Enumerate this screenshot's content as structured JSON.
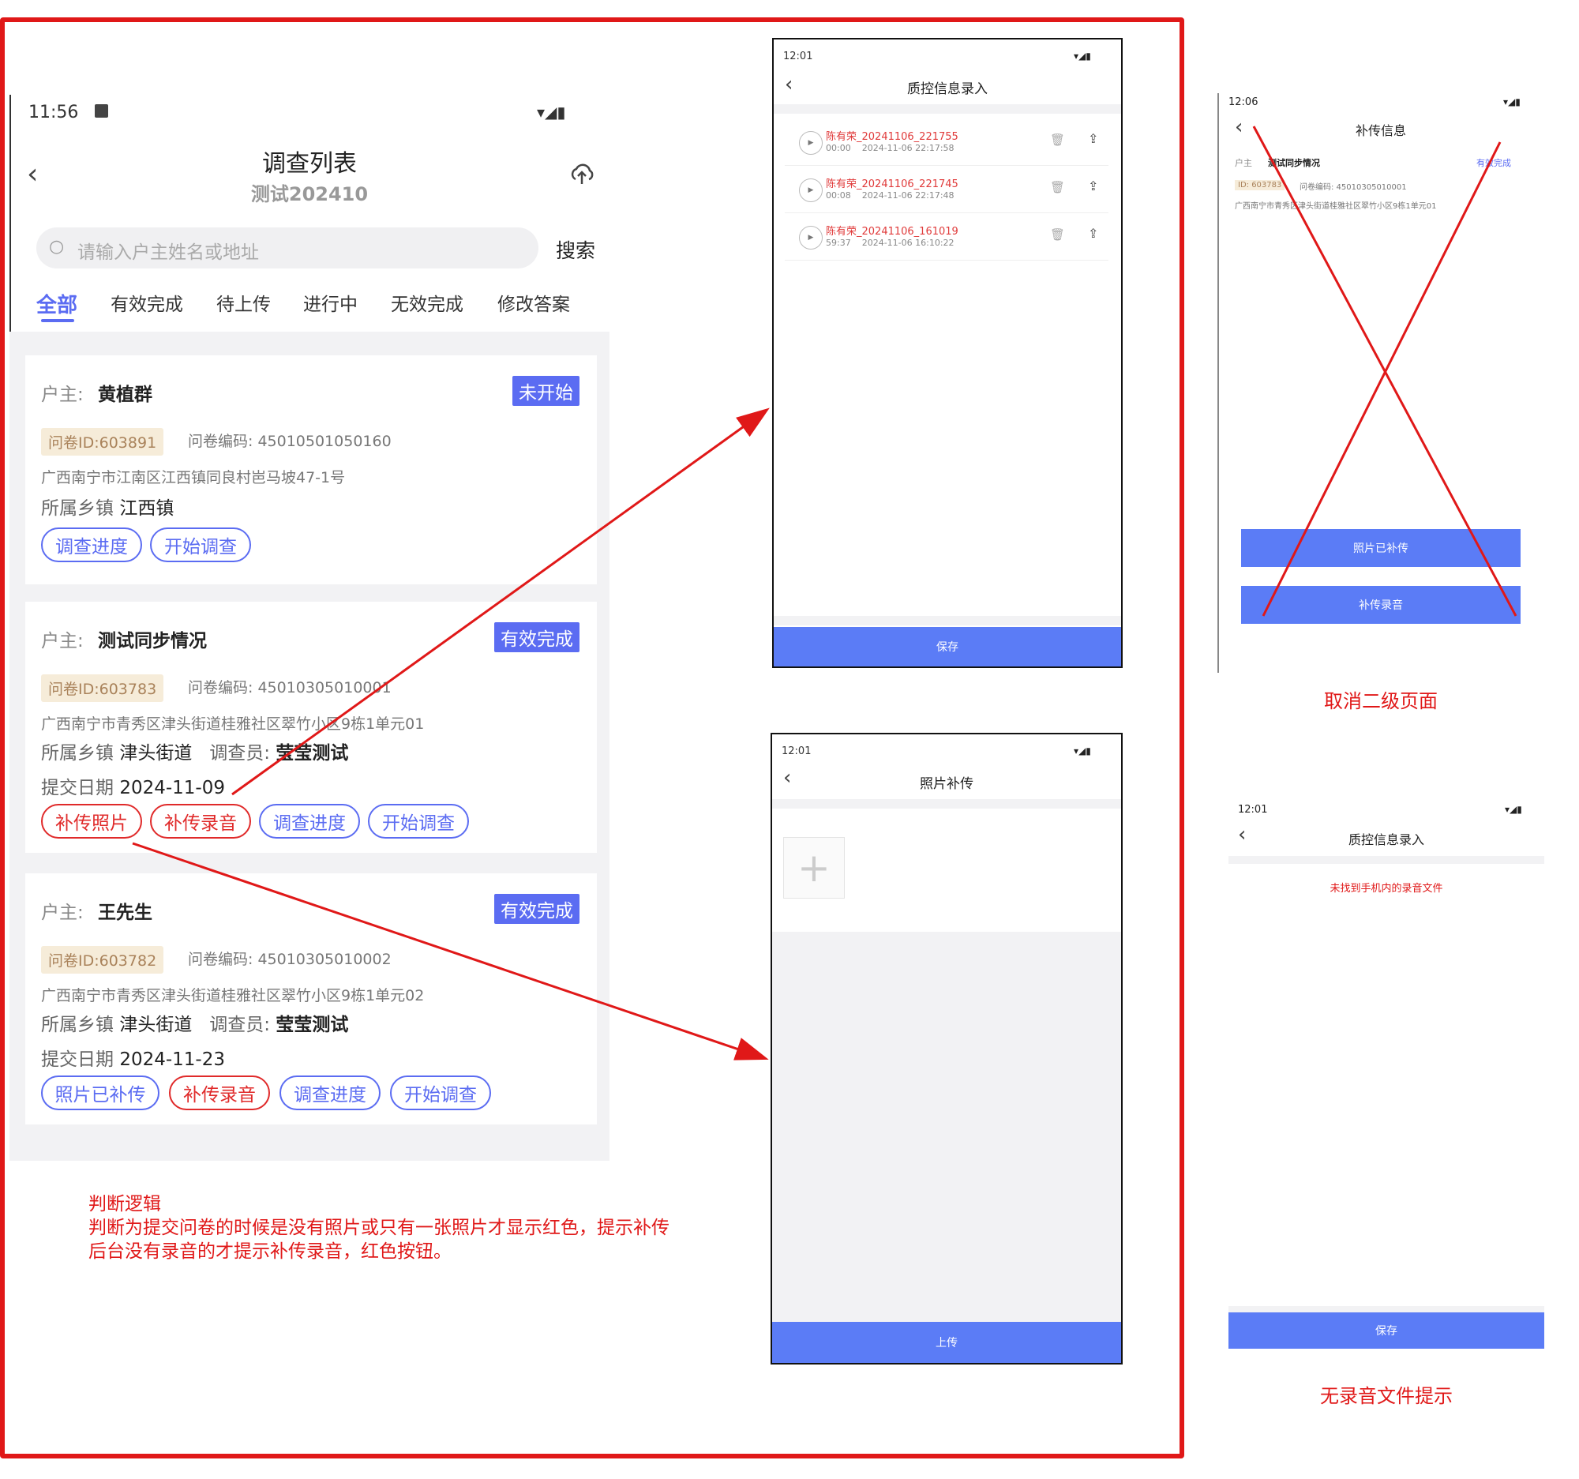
{
  "main": {
    "status_time": "11:56",
    "title": "调查列表",
    "subtitle": "测试202410",
    "search_placeholder": "请输入户主姓名或地址",
    "search_button": "搜索",
    "tabs": [
      "全部",
      "有效完成",
      "待上传",
      "进行中",
      "无效完成",
      "修改答案"
    ],
    "labels": {
      "owner": "户主:",
      "township": "所属乡镇",
      "surveyor": "调查员:",
      "submit_date": "提交日期"
    },
    "cards": [
      {
        "owner": "黄植群",
        "status": "未开始",
        "qid": "问卷ID:603891",
        "code": "问卷编码: 45010501050160",
        "address": "广西南宁市江南区江西镇同良村岜马坡47-1号",
        "township": "江西镇",
        "buttons": [
          "调查进度",
          "开始调查"
        ]
      },
      {
        "owner": "测试同步情况",
        "status": "有效完成",
        "qid": "问卷ID:603783",
        "code": "问卷编码: 45010305010001",
        "address": "广西南宁市青秀区津头街道桂雅社区翠竹小区9栋1单元01",
        "township": "津头街道",
        "surveyor": "莹莹测试",
        "date": "2024-11-09",
        "buttons": [
          "补传照片",
          "补传录音",
          "调查进度",
          "开始调查"
        ]
      },
      {
        "owner": "王先生",
        "status": "有效完成",
        "qid": "问卷ID:603782",
        "code": "问卷编码: 45010305010002",
        "address": "广西南宁市青秀区津头街道桂雅社区翠竹小区9栋1单元02",
        "township": "津头街道",
        "surveyor": "莹莹测试",
        "date": "2024-11-23",
        "buttons": [
          "照片已补传",
          "补传录音",
          "调查进度",
          "开始调查"
        ]
      }
    ]
  },
  "note": {
    "title": "判断逻辑",
    "line1": "判断为提交问卷的时候是没有照片或只有一张照片才显示红色，提示补传",
    "line2": "后台没有录音的才提示补传录音，红色按钮。"
  },
  "audio_screen": {
    "time": "12:01",
    "title": "质控信息录入",
    "records": [
      {
        "name": "陈有荣_20241106_221755",
        "dur": "00:00",
        "ts": "2024-11-06 22:17:58"
      },
      {
        "name": "陈有荣_20241106_221745",
        "dur": "00:08",
        "ts": "2024-11-06 22:17:48"
      },
      {
        "name": "陈有荣_20241106_161019",
        "dur": "59:37",
        "ts": "2024-11-06 16:10:22"
      }
    ],
    "save": "保存"
  },
  "photo_screen": {
    "time": "12:01",
    "title": "照片补传",
    "upload": "上传"
  },
  "supplement_screen": {
    "time": "12:06",
    "title": "补传信息",
    "owner_label": "户主",
    "owner": "测试同步情况",
    "status": "有效完成",
    "id": "ID: 603783",
    "code": "问卷编码: 45010305010001",
    "address": "广西南宁市青秀区津头街道桂雅社区翠竹小区9栋1单元01",
    "btn1": "照片已补传",
    "btn2": "补传录音",
    "caption": "取消二级页面"
  },
  "no_audio_screen": {
    "time": "12:01",
    "title": "质控信息录入",
    "message": "未找到手机内的录音文件",
    "save": "保存",
    "caption": "无录音文件提示"
  },
  "colors": {
    "accent": "#5b6cf2",
    "warning": "#e02a2a",
    "frame": "#e01818"
  }
}
